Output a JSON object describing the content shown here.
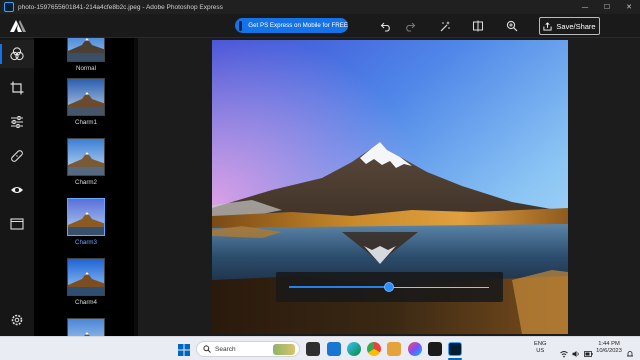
{
  "window": {
    "title": "photo-1597655601841-214a4cfe8b2c.jpeg - Adobe Photoshop Express",
    "controls": [
      "—",
      "☐",
      "✕"
    ]
  },
  "toolbar": {
    "promo_label": "Get PS Express on Mobile for FREE",
    "save_label": "Save/Share",
    "icons": [
      "undo-icon",
      "redo-icon",
      "auto-fix-icon",
      "compare-icon",
      "zoom-icon",
      "share-icon"
    ]
  },
  "rail": {
    "items": [
      {
        "name": "looks-icon",
        "active": true
      },
      {
        "name": "crop-icon",
        "active": false
      },
      {
        "name": "adjustments-icon",
        "active": false
      },
      {
        "name": "healing-icon",
        "active": false
      },
      {
        "name": "red-eye-icon",
        "active": false
      },
      {
        "name": "borders-icon",
        "active": false
      },
      {
        "name": "settings-icon",
        "active": false
      }
    ]
  },
  "looks": {
    "items": [
      {
        "label": "Normal",
        "selected": false
      },
      {
        "label": "Charm1",
        "selected": false
      },
      {
        "label": "Charm2",
        "selected": false
      },
      {
        "label": "Charm3",
        "selected": true
      },
      {
        "label": "Charm4",
        "selected": false
      },
      {
        "label": "",
        "selected": false
      }
    ]
  },
  "slider": {
    "value_fraction": 0.5
  },
  "taskbar": {
    "search_placeholder": "Search",
    "language": "ENG",
    "region": "US",
    "time": "1:44 PM",
    "date": "10/6/2023"
  },
  "colors": {
    "accent": "#1473e6",
    "selected_label": "#6aa9ff"
  }
}
